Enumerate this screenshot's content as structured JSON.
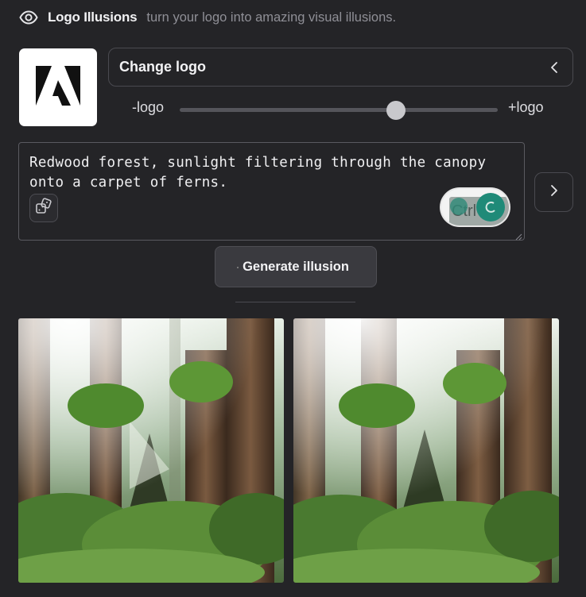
{
  "header": {
    "title": "Logo Illusions",
    "subtitle": "turn your logo into amazing visual illusions."
  },
  "logo": {
    "icon": "adobe-logo-icon",
    "background": "#ffffff"
  },
  "change_logo": {
    "label": "Change logo",
    "icon": "chevron-left-icon"
  },
  "slider": {
    "min_label": "-logo",
    "max_label": "+logo",
    "value": 0.68
  },
  "prompt": {
    "text": "Redwood forest, sunlight filtering through the canopy onto a carpet of ferns.",
    "dice_icon": "dice-icon",
    "overlay_badge": "Ctrl"
  },
  "next_button": {
    "icon": "chevron-right-icon"
  },
  "generate": {
    "label": "Generate illusion"
  },
  "results": [
    {
      "name": "result-image-1",
      "description_icon": "forest-illusion-image"
    },
    {
      "name": "result-image-2",
      "description_icon": "forest-illusion-image"
    }
  ],
  "colors": {
    "background": "#242427",
    "border": "#4a4a50",
    "text": "#f0f0f2",
    "muted": "#8f8f96",
    "accent_green": "#1f8a78"
  }
}
